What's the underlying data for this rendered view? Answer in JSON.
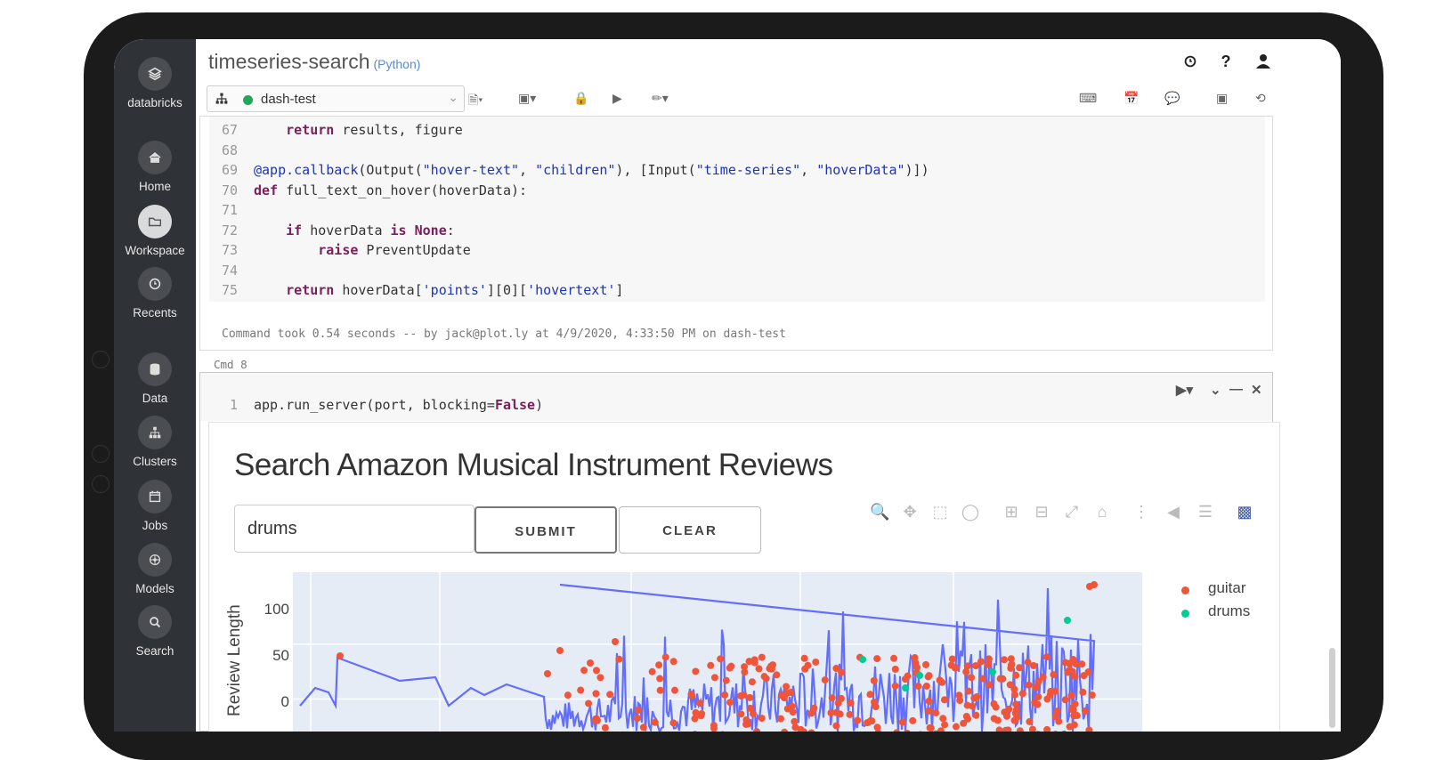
{
  "app": {
    "title": "timeseries-search",
    "language": "(Python)"
  },
  "sidebar": {
    "brand": "databricks",
    "items": [
      {
        "label": "Home",
        "icon": "home-icon"
      },
      {
        "label": "Workspace",
        "icon": "folder-icon"
      },
      {
        "label": "Recents",
        "icon": "clock-icon"
      },
      {
        "label": "Data",
        "icon": "database-icon"
      },
      {
        "label": "Clusters",
        "icon": "cluster-icon"
      },
      {
        "label": "Jobs",
        "icon": "calendar-icon"
      },
      {
        "label": "Models",
        "icon": "models-icon"
      },
      {
        "label": "Search",
        "icon": "search-icon"
      }
    ]
  },
  "toolbar": {
    "cluster": "dash-test"
  },
  "cell1": {
    "lines": [
      {
        "n": "67",
        "code": "    return results, figure"
      },
      {
        "n": "68",
        "code": ""
      },
      {
        "n": "69",
        "code": "@app.callback(Output(\"hover-text\", \"children\"), [Input(\"time-series\", \"hoverData\")])"
      },
      {
        "n": "70",
        "code": "def full_text_on_hover(hoverData):"
      },
      {
        "n": "71",
        "code": ""
      },
      {
        "n": "72",
        "code": "    if hoverData is None:"
      },
      {
        "n": "73",
        "code": "        raise PreventUpdate"
      },
      {
        "n": "74",
        "code": ""
      },
      {
        "n": "75",
        "code": "    return hoverData['points'][0]['hovertext']"
      }
    ],
    "footer": "Command took 0.54 seconds -- by jack@plot.ly at 4/9/2020, 4:33:50 PM on dash-test"
  },
  "cmd_label": "Cmd 8",
  "cell2": {
    "line_no": "1",
    "code": "app.run_server(port, blocking=False)"
  },
  "dash": {
    "title": "Search Amazon Musical Instrument Reviews",
    "search_value": "drums",
    "submit": "SUBMIT",
    "clear": "CLEAR",
    "ylabel": "Review Length",
    "legend": [
      {
        "name": "guitar",
        "color": "#ef553b"
      },
      {
        "name": "drums",
        "color": "#00cc96"
      }
    ],
    "line_color": "#636efa"
  },
  "chart_data": {
    "type": "line",
    "ylabel": "Review Length",
    "yticks": [
      0,
      50,
      100
    ],
    "ylim": [
      0,
      130
    ],
    "series": [
      {
        "name": "guitar",
        "type": "scatter",
        "color": "#ef553b"
      },
      {
        "name": "drums",
        "type": "scatter",
        "color": "#00cc96"
      }
    ],
    "legend_position": "right"
  }
}
